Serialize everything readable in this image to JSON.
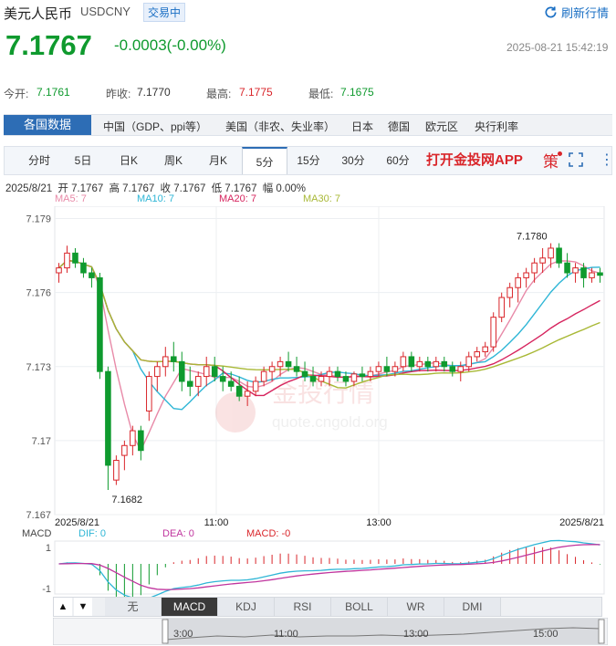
{
  "header": {
    "title": "美元人民币",
    "code": "USDCNY",
    "badge": "交易中",
    "refresh_label": "刷新行情",
    "price": "7.1767",
    "change": "-0.0003(-0.00%)",
    "timestamp": "2025-08-21 15:42:19"
  },
  "stats": {
    "open_label": "今开:",
    "open": "7.1761",
    "prev_label": "昨收:",
    "prev": "7.1770",
    "high_label": "最高:",
    "high": "7.1775",
    "low_label": "最低:",
    "low": "7.1675"
  },
  "category_tabs": {
    "active": "各国数据",
    "items": [
      "中国（GDP、ppi等）",
      "美国（非农、失业率）",
      "日本",
      "德国",
      "欧元区",
      "央行利率"
    ]
  },
  "period_tabs": {
    "items": [
      "分时",
      "5日",
      "日K",
      "周K",
      "月K",
      "5分",
      "15分",
      "30分",
      "60分"
    ],
    "selected": "5分",
    "app_link": "打开金投网APP",
    "strategy_label": "策"
  },
  "ohlc": {
    "date": "2025/8/21",
    "open": "开 7.1767",
    "high": "高 7.1767",
    "close": "收 7.1767",
    "low": "低 7.1767",
    "amp": "幅 0.00%"
  },
  "ma_legend": {
    "ma5": "MA5: 7",
    "ma10": "MA10: 7",
    "ma20": "MA20: 7",
    "ma30": "MA30: 7"
  },
  "colors": {
    "up": "#d9252a",
    "down": "#0f9a2e",
    "ma5": "#e88aa8",
    "ma10": "#2fb6d6",
    "ma20": "#d6245e",
    "ma30": "#a8b835",
    "accent": "#2d6db5"
  },
  "chart_data": {
    "type": "candlestick",
    "y_ticks": [
      "7.179",
      "7.176",
      "7.173",
      "7.17",
      "7.167"
    ],
    "ylim": [
      7.167,
      7.1795
    ],
    "x_ticks": [
      "2025/8/21",
      "11:00",
      "13:00",
      "2025/8/21"
    ],
    "high_annotation": "7.1780",
    "low_annotation": "7.1682",
    "ohlc": [
      [
        7.1768,
        7.1772,
        7.1764,
        7.177
      ],
      [
        7.177,
        7.1779,
        7.1768,
        7.1776
      ],
      [
        7.1776,
        7.1778,
        7.177,
        7.1772
      ],
      [
        7.1772,
        7.1774,
        7.1766,
        7.1768
      ],
      [
        7.1768,
        7.177,
        7.1762,
        7.1766
      ],
      [
        7.1766,
        7.1768,
        7.1725,
        7.1728
      ],
      [
        7.1728,
        7.173,
        7.168,
        7.169
      ],
      [
        7.1684,
        7.1694,
        7.1682,
        7.1692
      ],
      [
        7.1694,
        7.17,
        7.1688,
        7.1698
      ],
      [
        7.1698,
        7.1706,
        7.1694,
        7.1704
      ],
      [
        7.1704,
        7.1706,
        7.1692,
        7.1696
      ],
      [
        7.1712,
        7.1728,
        7.1708,
        7.1726
      ],
      [
        7.1726,
        7.1732,
        7.172,
        7.173
      ],
      [
        7.173,
        7.1738,
        7.1726,
        7.1734
      ],
      [
        7.1734,
        7.174,
        7.1728,
        7.1732
      ],
      [
        7.1732,
        7.1736,
        7.172,
        7.1724
      ],
      [
        7.1724,
        7.173,
        7.1718,
        7.1722
      ],
      [
        7.1722,
        7.1728,
        7.1718,
        7.1726
      ],
      [
        7.1726,
        7.1734,
        7.1722,
        7.173
      ],
      [
        7.173,
        7.1734,
        7.1724,
        7.1726
      ],
      [
        7.1726,
        7.173,
        7.172,
        7.1724
      ],
      [
        7.1724,
        7.1728,
        7.172,
        7.1722
      ],
      [
        7.1722,
        7.1726,
        7.1716,
        7.1718
      ],
      [
        7.1718,
        7.1724,
        7.1714,
        7.172
      ],
      [
        7.172,
        7.1726,
        7.1718,
        7.1724
      ],
      [
        7.1724,
        7.173,
        7.1722,
        7.1728
      ],
      [
        7.1728,
        7.1732,
        7.1724,
        7.173
      ],
      [
        7.173,
        7.1734,
        7.1726,
        7.1732
      ],
      [
        7.1732,
        7.1736,
        7.1728,
        7.173
      ],
      [
        7.173,
        7.1734,
        7.1726,
        7.1728
      ],
      [
        7.1728,
        7.1732,
        7.1724,
        7.1726
      ],
      [
        7.1726,
        7.173,
        7.1722,
        7.1724
      ],
      [
        7.1724,
        7.1728,
        7.1722,
        7.1726
      ],
      [
        7.1726,
        7.173,
        7.1722,
        7.1728
      ],
      [
        7.1728,
        7.173,
        7.1724,
        7.1726
      ],
      [
        7.1726,
        7.1728,
        7.1722,
        7.1724
      ],
      [
        7.1724,
        7.1728,
        7.1722,
        7.1727
      ],
      [
        7.1727,
        7.173,
        7.1724,
        7.1726
      ],
      [
        7.1726,
        7.173,
        7.1724,
        7.1728
      ],
      [
        7.1728,
        7.1732,
        7.1726,
        7.173
      ],
      [
        7.173,
        7.1734,
        7.1726,
        7.1728
      ],
      [
        7.1728,
        7.1732,
        7.1726,
        7.173
      ],
      [
        7.173,
        7.1736,
        7.1728,
        7.1734
      ],
      [
        7.1734,
        7.1736,
        7.1728,
        7.173
      ],
      [
        7.173,
        7.1734,
        7.1728,
        7.1732
      ],
      [
        7.1732,
        7.1734,
        7.1728,
        7.173
      ],
      [
        7.173,
        7.1734,
        7.1728,
        7.1732
      ],
      [
        7.1732,
        7.1734,
        7.1728,
        7.173
      ],
      [
        7.173,
        7.1732,
        7.1726,
        7.1728
      ],
      [
        7.1728,
        7.1732,
        7.1724,
        7.173
      ],
      [
        7.173,
        7.1736,
        7.1728,
        7.1734
      ],
      [
        7.1734,
        7.1738,
        7.1732,
        7.1736
      ],
      [
        7.1736,
        7.174,
        7.1734,
        7.1738
      ],
      [
        7.1738,
        7.1752,
        7.1736,
        7.175
      ],
      [
        7.175,
        7.176,
        7.1748,
        7.1758
      ],
      [
        7.1758,
        7.1764,
        7.1754,
        7.1762
      ],
      [
        7.1762,
        7.1768,
        7.1756,
        7.1766
      ],
      [
        7.1766,
        7.177,
        7.1762,
        7.1768
      ],
      [
        7.1768,
        7.1774,
        7.1764,
        7.1772
      ],
      [
        7.1772,
        7.1778,
        7.1768,
        7.1774
      ],
      [
        7.1774,
        7.178,
        7.177,
        7.1778
      ],
      [
        7.1778,
        7.178,
        7.177,
        7.1772
      ],
      [
        7.1772,
        7.1776,
        7.1766,
        7.1768
      ],
      [
        7.1768,
        7.1772,
        7.1764,
        7.177
      ],
      [
        7.177,
        7.1772,
        7.1762,
        7.1766
      ],
      [
        7.1766,
        7.177,
        7.1764,
        7.1768
      ],
      [
        7.1768,
        7.177,
        7.1764,
        7.1767
      ]
    ],
    "macd": {
      "label": "MACD",
      "dif": "DIF: 0",
      "dea": "DEA: 0",
      "macd": "MACD: -0",
      "y_ticks": [
        "1",
        "-1"
      ]
    }
  },
  "indicator_tabs": {
    "items": [
      "无",
      "MACD",
      "KDJ",
      "RSI",
      "BOLL",
      "WR",
      "DMI"
    ],
    "selected": "MACD",
    "up_arrow": "▲",
    "down_arrow": "▼"
  },
  "navigator": {
    "ticks": [
      "3:00",
      "11:00",
      "13:00",
      "15:00"
    ]
  },
  "watermark": {
    "brand": "金投行情",
    "site": "quote.cngold.org"
  }
}
